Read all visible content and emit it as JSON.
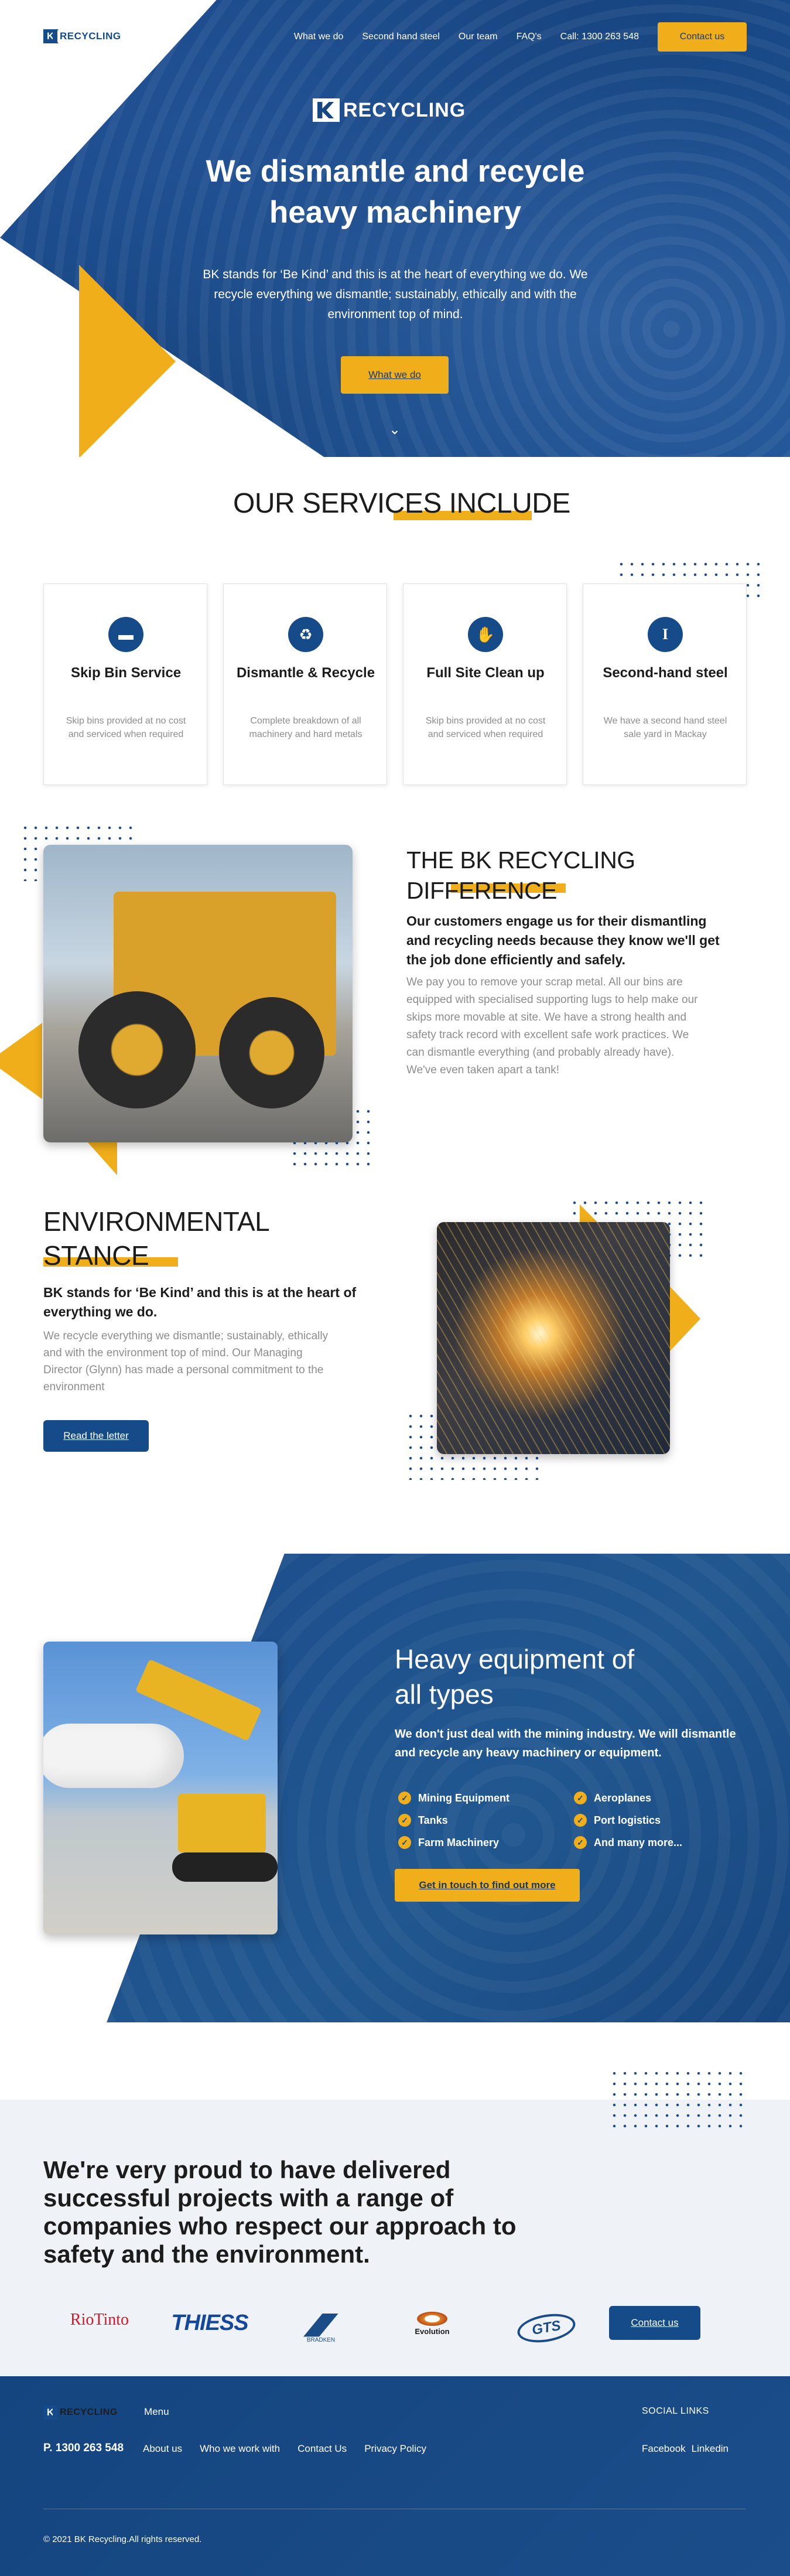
{
  "brand": {
    "name": "RECYCLING",
    "mark": "K"
  },
  "nav": {
    "links": [
      "What we do",
      "Second hand steel",
      "Our team",
      "FAQ's",
      "Call: 1300 263 548"
    ],
    "cta": "Contact us"
  },
  "hero": {
    "title": "We dismantle and recycle heavy machinery",
    "subtitle": "BK stands for ‘Be Kind’ and this is at the heart of everything we do. We recycle everything we dismantle; sustainably, ethically and with the environment top of mind.",
    "cta": "What we do",
    "scroll_icon": "chevron-down-icon"
  },
  "services": {
    "title": "OUR SERVICES INCLUDE",
    "cards": [
      {
        "icon": "dumpster-icon",
        "glyph": "▬",
        "title": "Skip Bin Service",
        "desc": "Skip bins provided at no cost and serviced when required"
      },
      {
        "icon": "recycle-icon",
        "glyph": "♻",
        "title": "Dismantle & Recycle",
        "desc": "Complete breakdown of all machinery and hard metals"
      },
      {
        "icon": "hands-icon",
        "glyph": "✋",
        "title": "Full Site Clean up",
        "desc": "Skip bins provided at no cost and serviced when required"
      },
      {
        "icon": "steel-beam-icon",
        "glyph": "I",
        "title": "Second-hand steel",
        "desc": "We have a second hand steel sale yard in Mackay"
      }
    ]
  },
  "difference": {
    "title_line1": "THE BK RECYCLING",
    "title_line2": "DIFFERENCE",
    "lead": "Our customers engage us for their dismantling and recycling needs because they know we'll get the job done efficiently and safely.",
    "body": "We pay you to remove your scrap metal. All our bins are equipped with specialised supporting lugs to help make our skips more movable at site. We have a strong health and safety track record with excellent safe work practices. We can dismantle everything (and probably already have). We've even taken apart a tank!"
  },
  "environment": {
    "title_line1": "ENVIRONMENTAL",
    "title_line2": "STANCE",
    "lead": "BK stands for ‘Be Kind’ and this is at the heart of everything we do.",
    "body": "We recycle everything we dismantle; sustainably, ethically and with the environment top of mind. Our Managing Director (Glynn) has made a personal commitment to the environment",
    "cta": "Read the letter"
  },
  "heavy": {
    "title_line1": "Heavy equipment of",
    "title_line2": "all types",
    "lead": "We don't just deal with the mining industry. We will dismantle and recycle any heavy machinery or equipment.",
    "items": [
      "Mining Equipment",
      "Aeroplanes",
      "Tanks",
      "Port logistics",
      "Farm Machinery",
      "And many more..."
    ],
    "cta": "Get in touch to find out more"
  },
  "partners": {
    "title": "We're very proud to have delivered successful projects with a range of companies who respect our approach to safety and the environment.",
    "logos": [
      "RioTinto",
      "THIESS",
      "BRADKEN",
      "Evolution",
      "GTS"
    ],
    "cta": "Contact us"
  },
  "footer": {
    "menu_label": "Menu",
    "phone": "P. 1300 263 548",
    "links": [
      "About us",
      "Who we work with",
      "Contact Us",
      "Privacy Policy"
    ],
    "social_title": "SOCIAL LINKS",
    "social": [
      "Facebook",
      "Linkedin"
    ],
    "copyright": "© 2021 BK Recycling.All rights reserved."
  },
  "colors": {
    "primary": "#164b8a",
    "accent": "#f0ae1a",
    "text_grey": "#8d8d8d",
    "light_bg": "#eff2f6"
  }
}
